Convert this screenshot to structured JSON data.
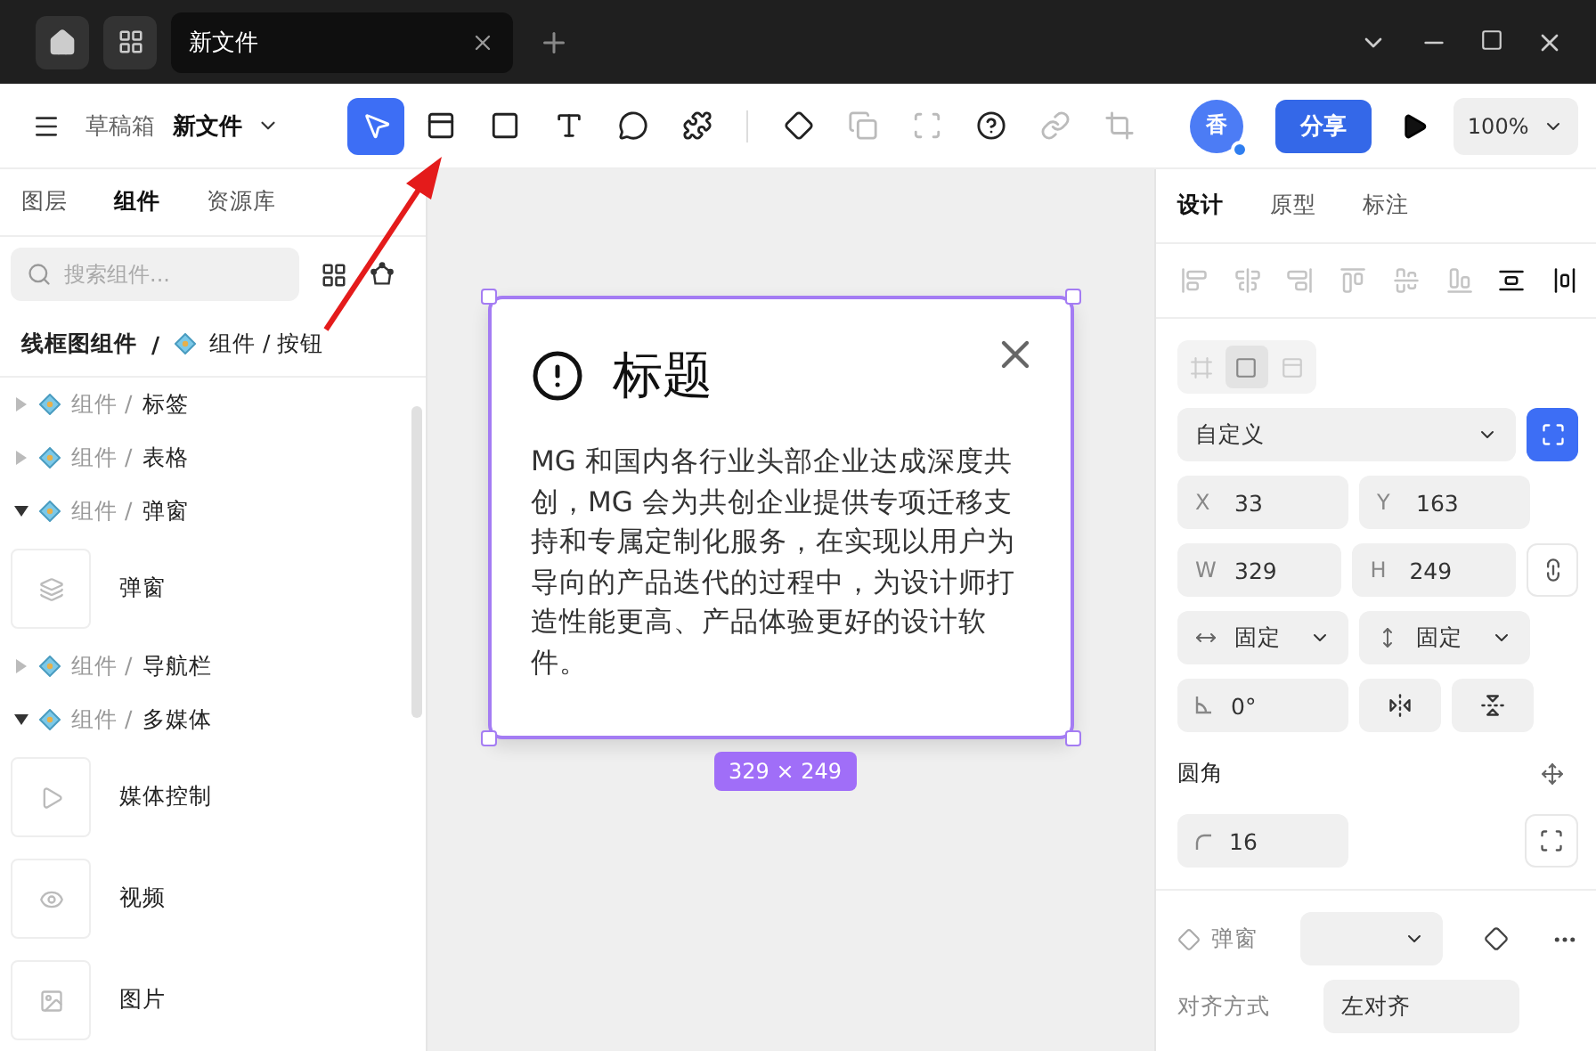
{
  "titlebar": {
    "tab": {
      "title": "新文件",
      "selected": true
    }
  },
  "toolbar": {
    "breadcrumb": {
      "folder": "草稿箱",
      "file": "新文件"
    },
    "tools": [
      {
        "kind": "pointer",
        "selected": true,
        "disabled": false
      },
      {
        "kind": "frame",
        "selected": false,
        "disabled": false
      },
      {
        "kind": "rect",
        "selected": false,
        "disabled": false
      },
      {
        "kind": "text",
        "selected": false,
        "disabled": false
      },
      {
        "kind": "bubble",
        "selected": false,
        "disabled": false
      },
      {
        "kind": "puzzle",
        "selected": false,
        "disabled": false
      },
      {
        "kind": "component",
        "selected": false,
        "disabled": false
      },
      {
        "kind": "boolean",
        "selected": false,
        "disabled": true
      },
      {
        "kind": "bounds",
        "selected": false,
        "disabled": true
      },
      {
        "kind": "mask",
        "selected": false,
        "disabled": false
      },
      {
        "kind": "link",
        "selected": false,
        "disabled": true
      },
      {
        "kind": "crop",
        "selected": false,
        "disabled": true
      }
    ],
    "avatar": "香",
    "share": "分享",
    "zoom": "100%"
  },
  "left_panel": {
    "tabs": [
      {
        "label": "图层",
        "selected": false
      },
      {
        "label": "组件",
        "selected": true
      },
      {
        "label": "资源库",
        "selected": false
      }
    ],
    "search": {
      "placeholder": "搜索组件..."
    },
    "path": {
      "library": "线框图组件",
      "separator": "/",
      "current": "组件 / 按钮"
    },
    "tree": [
      {
        "prefix": "组件 /",
        "name": "标签",
        "expanded": false
      },
      {
        "prefix": "组件 /",
        "name": "表格",
        "expanded": false
      },
      {
        "prefix": "组件 /",
        "name": "弹窗",
        "expanded": true,
        "children": [
          {
            "kind": "dialog",
            "name": "弹窗"
          }
        ]
      },
      {
        "prefix": "组件 /",
        "name": "导航栏",
        "expanded": false
      },
      {
        "prefix": "组件 /",
        "name": "多媒体",
        "expanded": true,
        "children": [
          {
            "kind": "media",
            "name": "媒体控制"
          },
          {
            "kind": "video",
            "name": "视频"
          },
          {
            "kind": "image",
            "name": "图片"
          }
        ]
      }
    ]
  },
  "canvas": {
    "dialog": {
      "title": "标题",
      "body": "MG 和国内各行业头部企业达成深度共创，MG 会为共创企业提供专项迁移支持和专属定制化服务，在实现以用户为导向的产品迭代的过程中，为设计师打造性能更高、产品体验更好的设计软件。"
    },
    "size_label": "329 × 249"
  },
  "right_panel": {
    "tabs": [
      {
        "label": "设计",
        "selected": true
      },
      {
        "label": "原型",
        "selected": false
      },
      {
        "label": "标注",
        "selected": false
      }
    ],
    "align": [
      {
        "kind": "left",
        "disabled": true
      },
      {
        "kind": "hcenter",
        "disabled": true
      },
      {
        "kind": "right",
        "disabled": true
      },
      {
        "kind": "top",
        "disabled": true
      },
      {
        "kind": "vcenter",
        "disabled": true
      },
      {
        "kind": "bottom",
        "disabled": true
      },
      {
        "kind": "vdist",
        "disabled": false
      },
      {
        "kind": "hdist",
        "disabled": false
      }
    ],
    "frame_modes": [
      {
        "selected": false
      },
      {
        "selected": true
      },
      {
        "selected": false
      }
    ],
    "preset": "自定义",
    "fields": [
      {
        "label": "X",
        "value": "33"
      },
      {
        "label": "Y",
        "value": "163"
      },
      {
        "label": "W",
        "value": "329"
      },
      {
        "label": "H",
        "value": "249"
      }
    ],
    "sizing": [
      "固定",
      "固定"
    ],
    "rotation": "0°",
    "radius_title": "圆角",
    "radius": "16",
    "component_name": "弹窗",
    "align_label": "对齐方式",
    "align_value": "左对齐"
  }
}
